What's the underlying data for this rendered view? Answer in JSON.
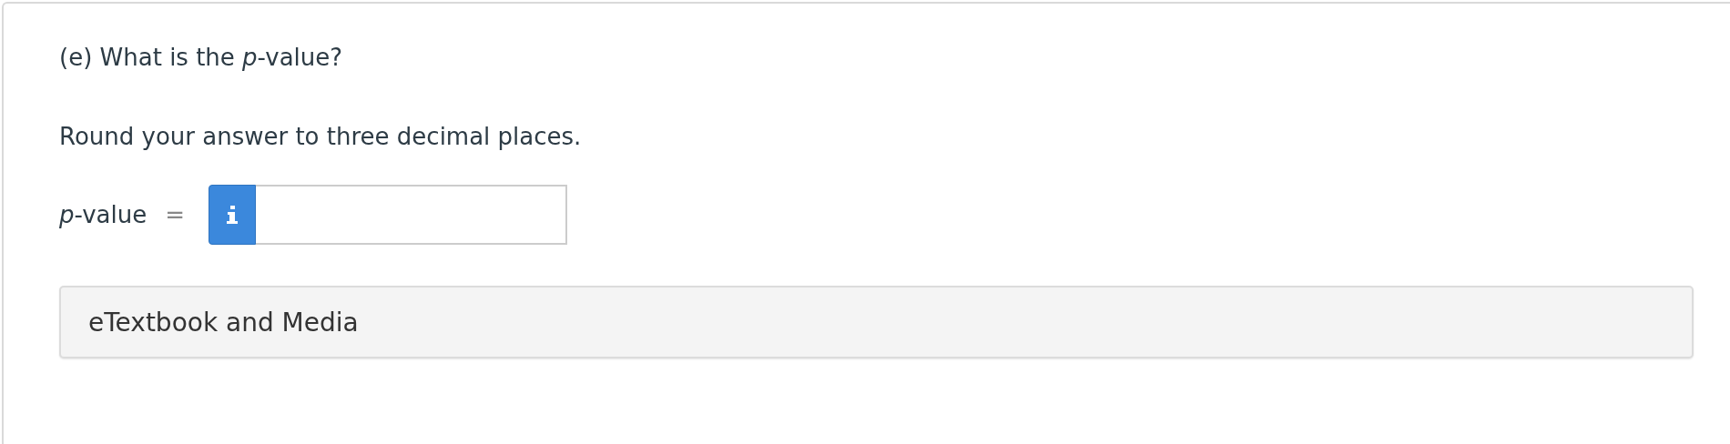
{
  "question": {
    "prompt": "(e) What is the *p*-value?",
    "instruction": "Round your answer to three decimal places."
  },
  "answer": {
    "label": "*p*-value",
    "relation": "="
  },
  "resources": {
    "title": "eTextbook and Media"
  }
}
